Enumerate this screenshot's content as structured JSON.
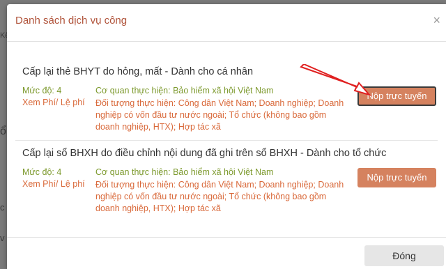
{
  "modal": {
    "title": "Danh sách dịch vụ công",
    "close_icon": "×",
    "close_button_label": "Đóng"
  },
  "background": {
    "fragments": [
      "Kê",
      "ổi",
      "c",
      "v"
    ]
  },
  "services": [
    {
      "title": "Cấp lại thẻ BHYT do hỏng, mất - Dành cho cá nhân",
      "level": "Mức độ: 4",
      "fee_link": "Xem Phí/ Lệ phí",
      "agency": "Cơ quan thực hiện: Bảo hiểm xã hội Việt Nam",
      "subjects": "Đối tượng thực hiện: Công dân Việt Nam; Doanh nghiệp; Doanh nghiệp có vốn đầu tư nước ngoài; Tổ chức (không bao gồm doanh nghiệp, HTX); Hợp tác xã",
      "submit_label": "Nộp trực tuyến"
    },
    {
      "title": "Cấp lại sổ BHXH do điều chỉnh nội dung đã ghi trên sổ BHXH - Dành cho tổ chức",
      "level": "Mức độ: 4",
      "fee_link": "Xem Phí/ Lệ phí",
      "agency": "Cơ quan thực hiện: Bảo hiểm xã hội Việt Nam",
      "subjects": "Đối tượng thực hiện: Công dân Việt Nam; Doanh nghiệp; Doanh nghiệp có vốn đầu tư nước ngoài; Tổ chức (không bao gồm doanh nghiệp, HTX); Hợp tác xã",
      "submit_label": "Nộp trực tuyến"
    }
  ],
  "colors": {
    "title": "#b0533a",
    "level_green": "#7d9a2e",
    "fee_orange": "#d9693a",
    "button": "#d5825f",
    "annotation_arrow": "#e02020"
  },
  "annotation": {
    "icon": "red-arrow-icon"
  }
}
